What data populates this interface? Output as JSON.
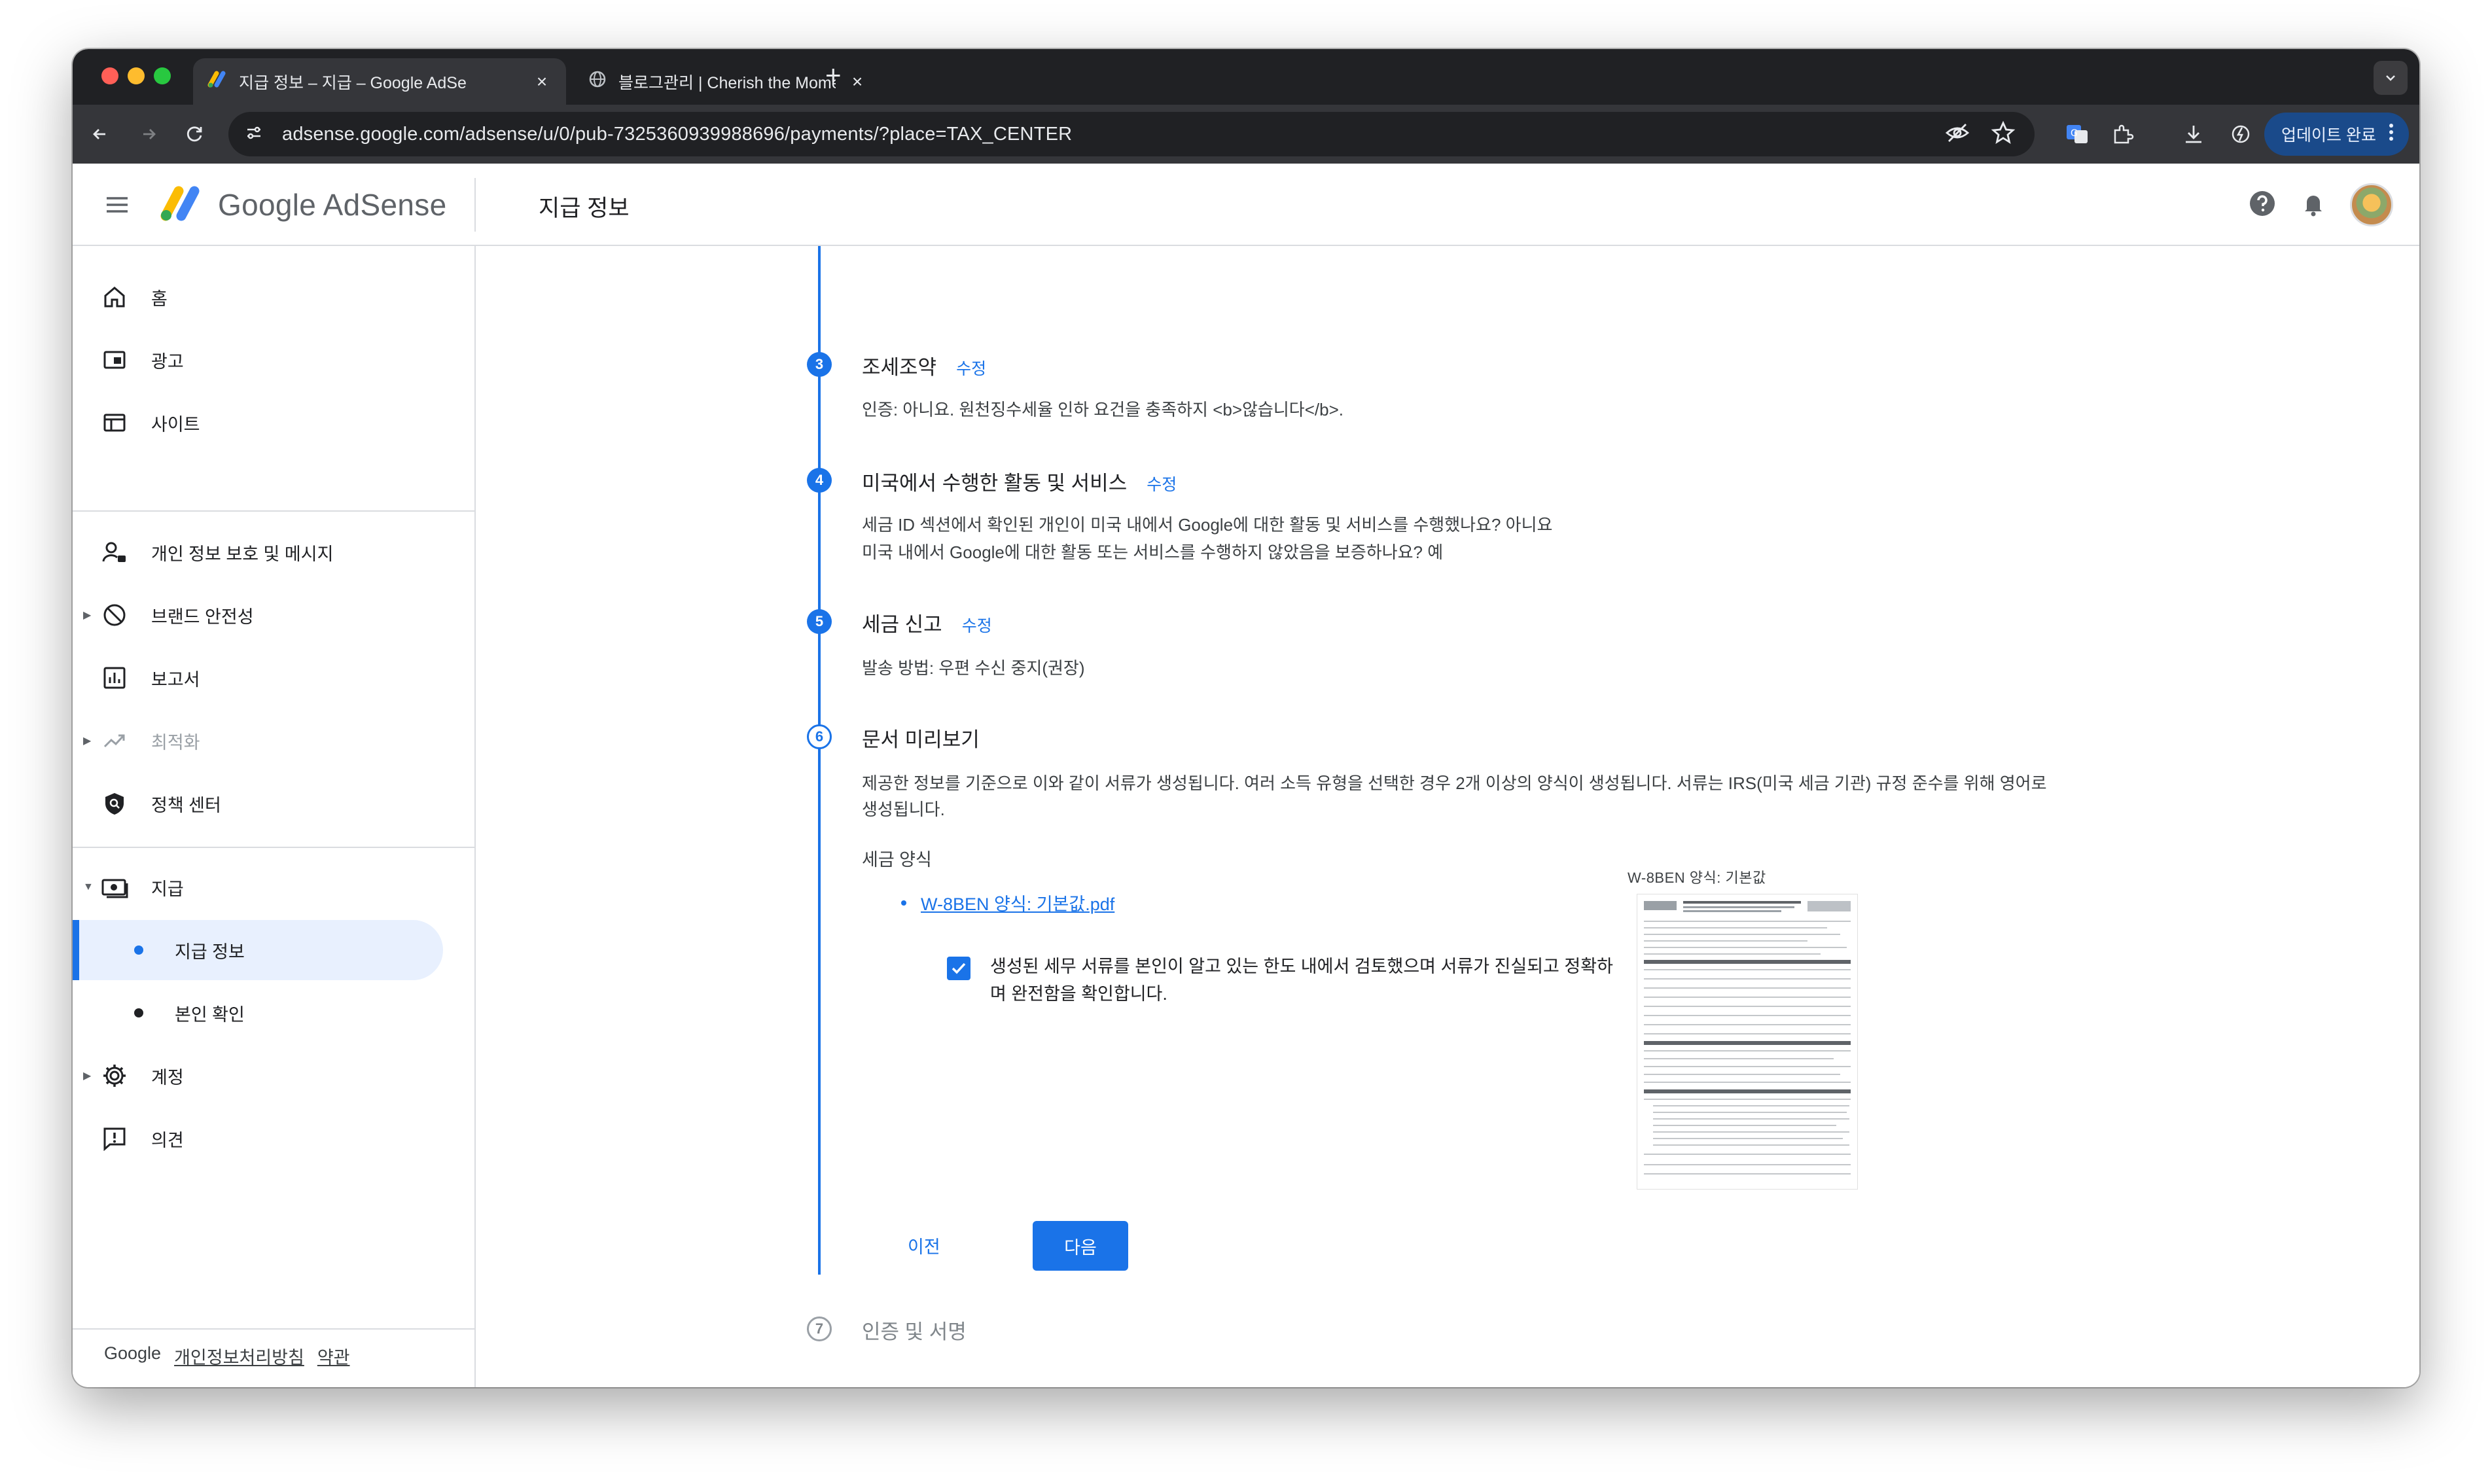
{
  "browser": {
    "tabs": [
      {
        "title": "지급 정보 – 지급 – Google AdSe",
        "active": true
      },
      {
        "title": "블로그관리 | Cherish the Mome",
        "active": false
      }
    ],
    "new_tab": "+",
    "url": "adsense.google.com/adsense/u/0/pub-7325360939988696/payments/?place=TAX_CENTER",
    "update_button": "업데이트 완료",
    "colors": {
      "tabstrip": "#202124",
      "toolbar": "#35363a"
    }
  },
  "app": {
    "brand": "Google AdSense",
    "page_title": "지급 정보",
    "accent": "#1a73e8"
  },
  "sidebar": {
    "items": [
      {
        "label": "홈",
        "icon": "home-icon"
      },
      {
        "label": "광고",
        "icon": "ads-icon"
      },
      {
        "label": "사이트",
        "icon": "sites-icon"
      },
      {
        "label": "개인 정보 보호 및 메시지",
        "icon": "privacy-icon"
      },
      {
        "label": "브랜드 안전성",
        "icon": "block-icon"
      },
      {
        "label": "보고서",
        "icon": "reports-icon"
      },
      {
        "label": "최적화",
        "icon": "trending-icon"
      },
      {
        "label": "정책 센터",
        "icon": "policy-shield-icon"
      },
      {
        "label": "지급",
        "icon": "payments-icon"
      },
      {
        "label": "지급 정보"
      },
      {
        "label": "본인 확인"
      },
      {
        "label": "계정",
        "icon": "gear-icon"
      },
      {
        "label": "의견",
        "icon": "feedback-icon"
      }
    ],
    "footer": {
      "brand": "Google",
      "privacy": "개인정보처리방침",
      "terms": "약관"
    }
  },
  "steps": {
    "s3": {
      "num": "3",
      "title": "조세조약",
      "edit": "수정",
      "body": "인증: 아니요. 원천징수세율 인하 요건을 충족하지 <b>않습니다</b>."
    },
    "s4": {
      "num": "4",
      "title": "미국에서 수행한 활동 및 서비스",
      "edit": "수정",
      "line1": "세금 ID 섹션에서 확인된 개인이 미국 내에서 Google에 대한 활동 및 서비스를 수행했나요? 아니요",
      "line2": "미국 내에서 Google에 대한 활동 또는 서비스를 수행하지 않았음을 보증하나요? 예"
    },
    "s5": {
      "num": "5",
      "title": "세금 신고",
      "edit": "수정",
      "body": "발송 방법: 우편 수신 중지(권장)"
    },
    "s6": {
      "num": "6",
      "title": "문서 미리보기",
      "line1": "제공한 정보를 기준으로 이와 같이 서류가 생성됩니다. 여러 소득 유형을 선택한 경우 2개 이상의 양식이 생성됩니다. 서류는 IRS(미국 세금 기관) 규정 준수를 위해 영어로",
      "line2": "생성됩니다.",
      "form_label": "세금 양식",
      "pdf_link": "W-8BEN 양식: 기본값.pdf",
      "confirm_line1": "생성된 세무 서류를 본인이 알고 있는 한도 내에서 검토했으며 서류가 진실되고 정확하",
      "confirm_line2": "며 완전함을 확인합니다.",
      "confirm_checked": true,
      "preview_label": "W-8BEN 양식: 기본값",
      "prev_button": "이전",
      "next_button": "다음"
    },
    "s7": {
      "num": "7",
      "title": "인증 및 서명"
    }
  }
}
